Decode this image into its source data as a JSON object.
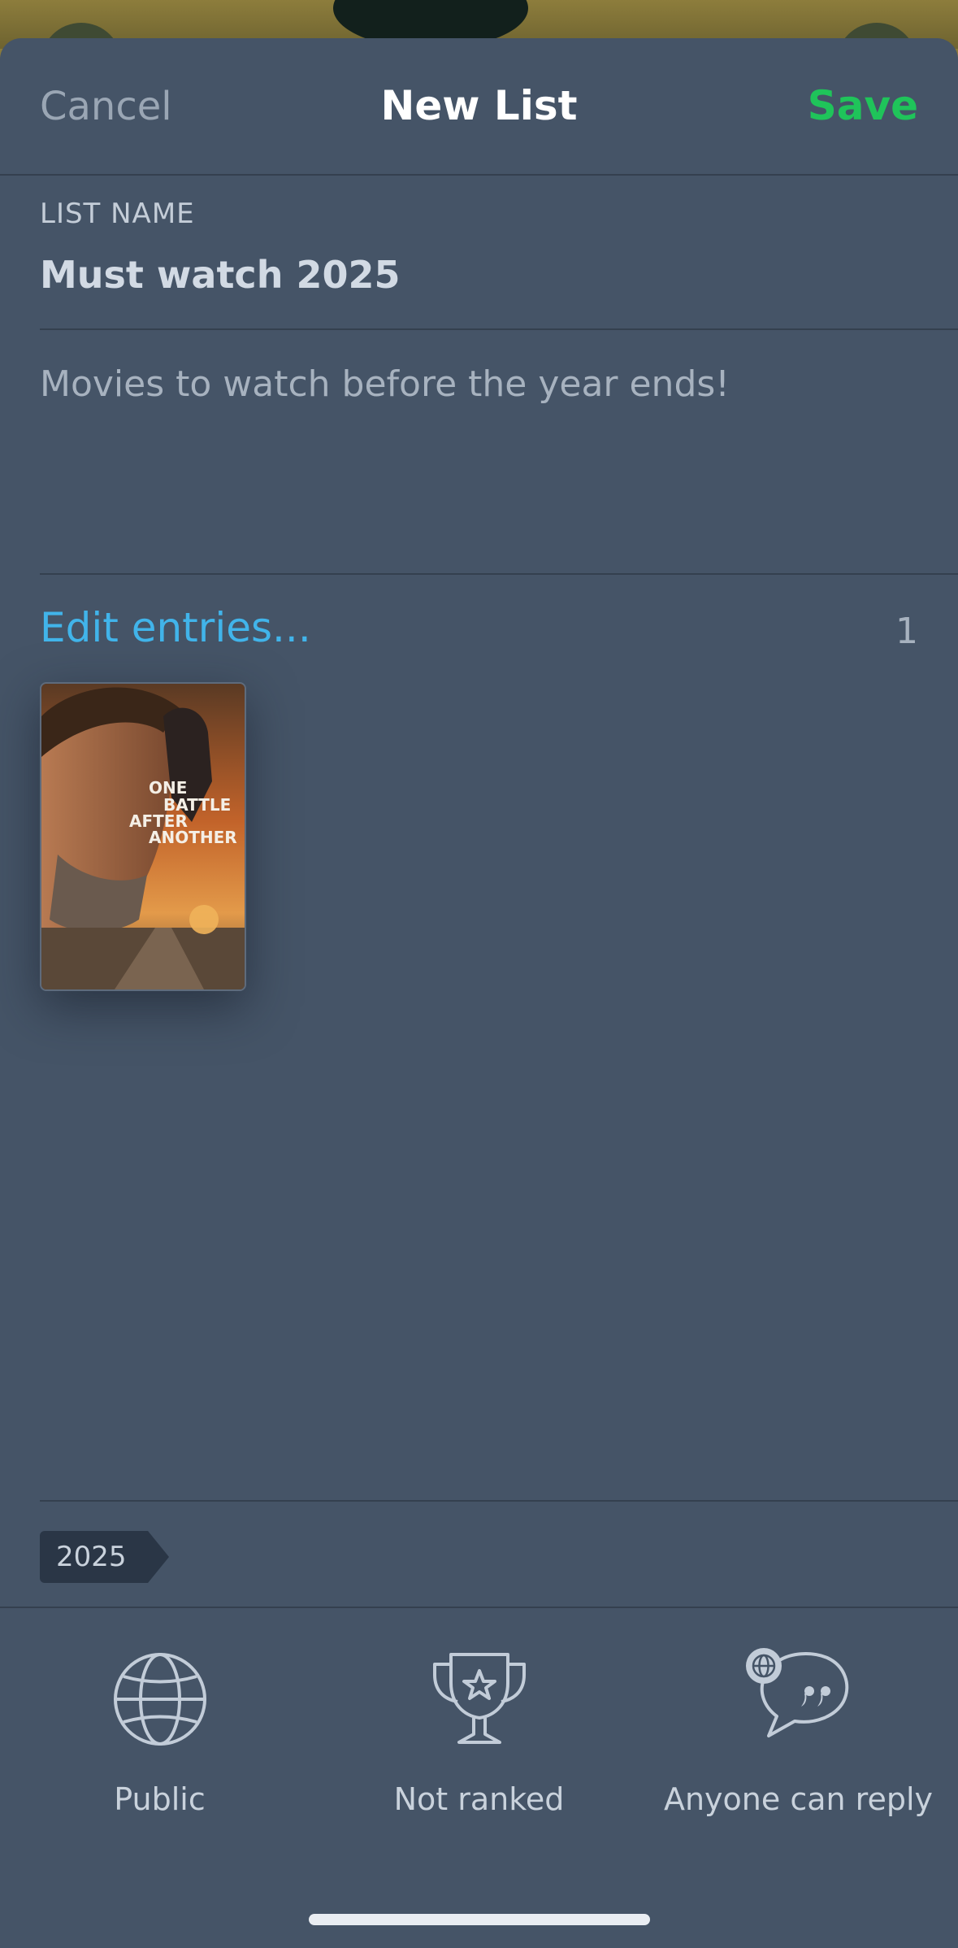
{
  "header": {
    "cancel_label": "Cancel",
    "title": "New List",
    "save_label": "Save"
  },
  "list_name": {
    "label": "LIST NAME",
    "value": "Must watch 2025"
  },
  "description": {
    "value": "Movies to watch before the year ends!"
  },
  "entries": {
    "edit_label": "Edit entries...",
    "count": "1",
    "items": [
      {
        "title_lines": [
          "ONE",
          "BATTLE",
          "AFTER",
          "ANOTHER"
        ],
        "poster_icon": "movie-poster"
      }
    ]
  },
  "tags": [
    "2025"
  ],
  "options": [
    {
      "icon": "globe-icon",
      "label": "Public"
    },
    {
      "icon": "trophy-icon",
      "label": "Not ranked"
    },
    {
      "icon": "reply-icon",
      "label": "Anyone can reply"
    }
  ],
  "colors": {
    "sheet_bg": "#455467",
    "accent_save": "#1fc45a",
    "link_blue": "#41b4ea"
  }
}
